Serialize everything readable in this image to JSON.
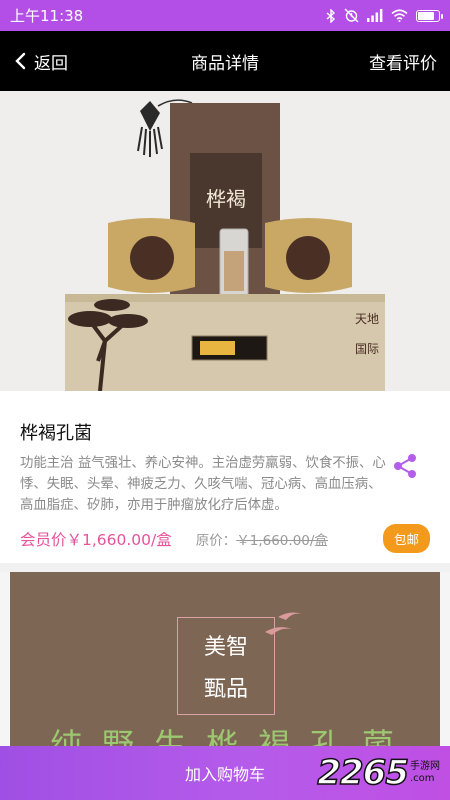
{
  "status_bar": {
    "time": "上午11:38",
    "bg": "#b34fe6",
    "battery_level": 0.85,
    "icons": [
      "bluetooth-icon",
      "alarm-off-icon",
      "signal-icon",
      "wifi-icon",
      "battery-icon"
    ]
  },
  "nav": {
    "back_label": "返回",
    "title": "商品详情",
    "reviews_label": "查看评价"
  },
  "product": {
    "name": "桦褐孔菌",
    "description": "功能主治 益气强壮、养心安神。主治虚劳羸弱、饮食不振、心悸、失眠、头晕、神疲乏力、久咳气喘、冠心病、高血压病、高血脂症、矽肺，亦用于肿瘤放化疗后体虚。",
    "member_price": "会员价￥1,660.00/盒",
    "original_price_label": "原价：",
    "original_price": "￥1,660.00/盒",
    "shipping_badge": "包邮",
    "accent_color": "#e6539c",
    "badge_color": "#f39a1d"
  },
  "detail_image": {
    "brand_line1": "美智",
    "brand_line2": "甄品",
    "bottom_text": "纯野生桦褐孔菌"
  },
  "bottom_bar": {
    "add_to_cart": "加入购物车"
  },
  "watermark": {
    "number": "2265",
    "text": "手游网",
    "domain": ".com"
  }
}
